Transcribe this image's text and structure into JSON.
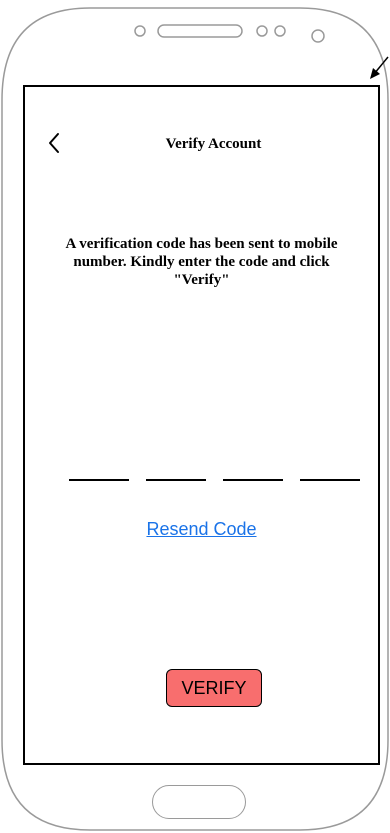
{
  "header": {
    "title": "Verify Account",
    "back_icon": "chevron-left-icon"
  },
  "message": "A verification code has been sent to mobile number. Kindly enter the code and click \"Verify\"",
  "code_inputs": [
    "",
    "",
    "",
    ""
  ],
  "resend_link": "Resend Code",
  "verify_button": "VERIFY",
  "colors": {
    "verify_button": "#f86e6e",
    "link": "#1a73e8",
    "frame": "#9a9a9a"
  }
}
